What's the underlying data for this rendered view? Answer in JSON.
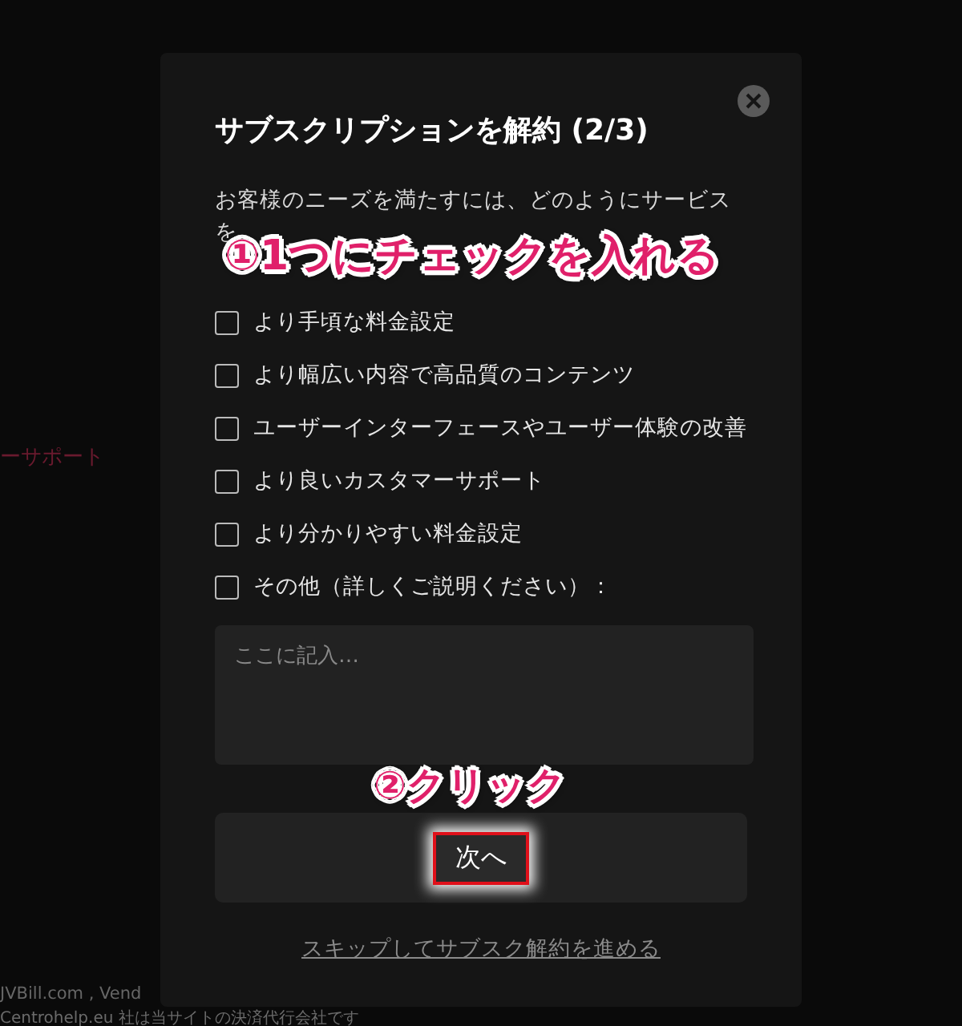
{
  "background": {
    "side_text": "ーサポート",
    "footer_line_1": "JVBill.com , Vend",
    "footer_line_2": "Centrohelp.eu 社は当サイトの決済代行会社です"
  },
  "dialog": {
    "title": "サブスクリプションを解約 (2/3)",
    "description": "お客様のニーズを満たすには、どのようにサービス",
    "description_line_2": "を",
    "options": [
      {
        "label": "より手頃な料金設定",
        "checked": false
      },
      {
        "label": "より幅広い内容で高品質のコンテンツ",
        "checked": false
      },
      {
        "label": "ユーザーインターフェースやユーザー体験の改善",
        "checked": false
      },
      {
        "label": "より良いカスタマーサポート",
        "checked": false
      },
      {
        "label": "より分かりやすい料金設定",
        "checked": false
      },
      {
        "label": "その他（詳しくご説明ください）：",
        "checked": false
      }
    ],
    "comment": {
      "placeholder": "ここに記入…"
    },
    "next_button": "次へ",
    "skip_link": "スキップしてサブスク解約を進める"
  },
  "annotations": [
    {
      "text": "①1つにチェックを入れる",
      "kind": "step"
    },
    {
      "text": "②クリック",
      "kind": "click"
    }
  ]
}
